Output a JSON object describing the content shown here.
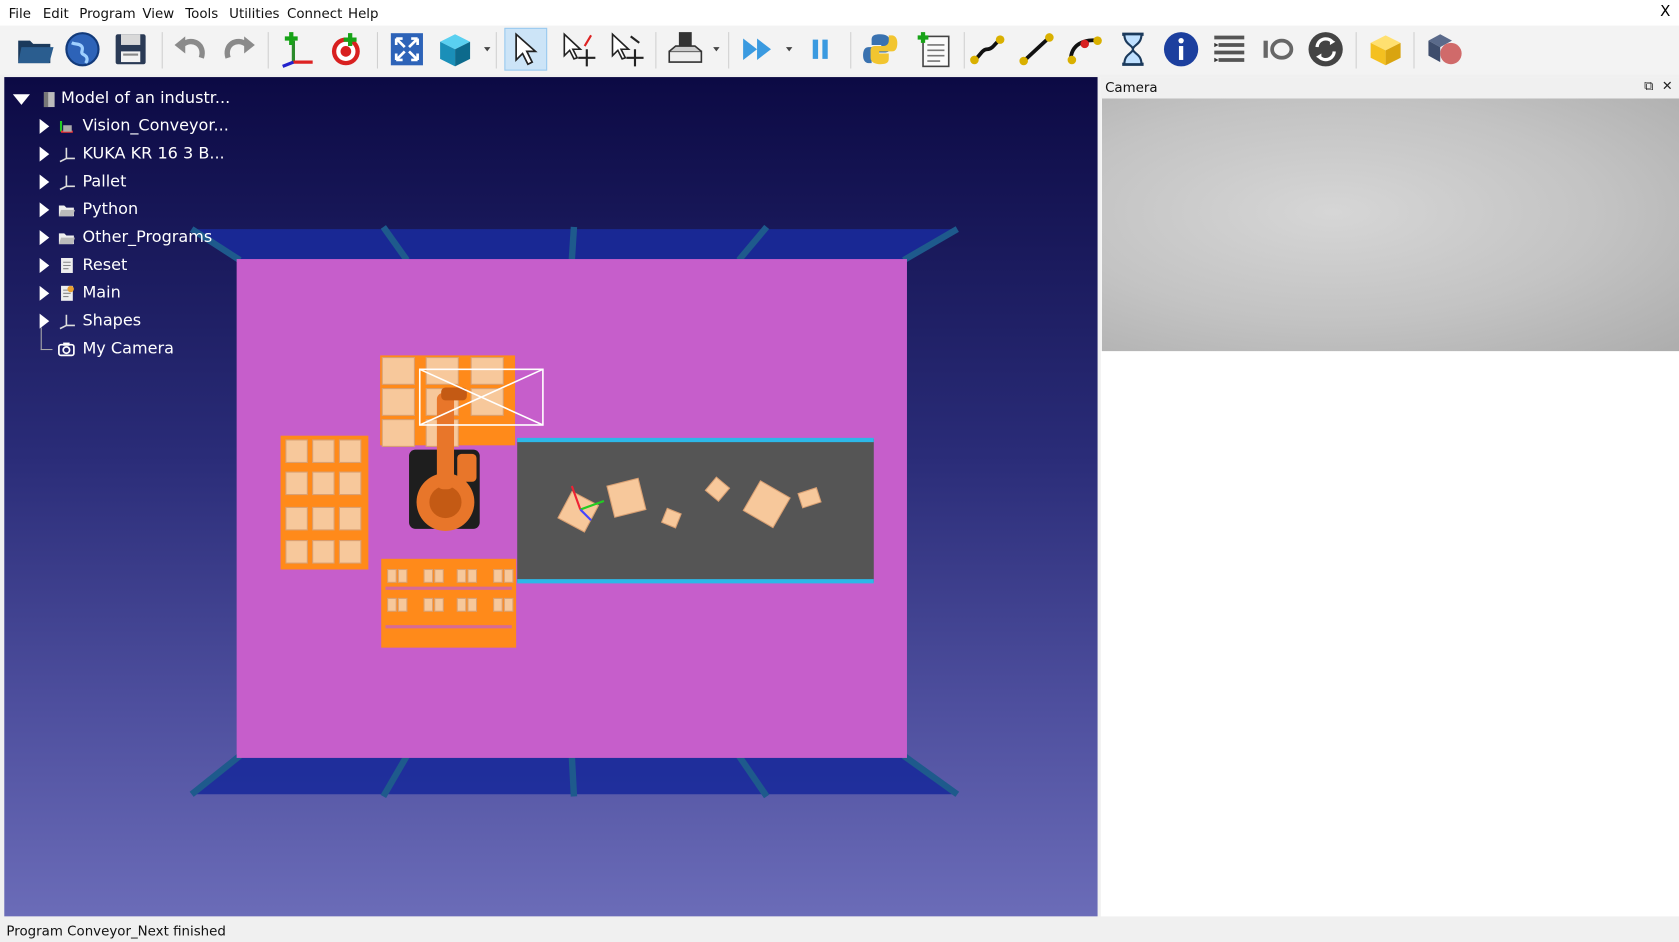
{
  "window": {
    "close_label": "X"
  },
  "menu": [
    "File",
    "Edit",
    "Program",
    "View",
    "Tools",
    "Utilities",
    "Connect",
    "Help"
  ],
  "toolbar": [
    "open-icon",
    "online-library-icon",
    "save-icon",
    "undo-icon",
    "redo-icon",
    "add-reference-frame-icon",
    "add-target-icon",
    "fit-all-icon",
    "view-3d-icon",
    "select-icon",
    "move-reference-icon",
    "move-object-icon",
    "tool-icon",
    "run-simulation-icon",
    "pause-icon",
    "add-python-program-icon",
    "add-program-icon",
    "joint-move-icon",
    "linear-move-icon",
    "circular-move-icon",
    "pause-instruction-icon",
    "info-icon",
    "program-instruction-icon",
    "io-icon",
    "reset-icon",
    "export-package-icon",
    "add-object-icon"
  ],
  "tree": {
    "root": "Model of an industr...",
    "items": [
      {
        "label": "Vision_Conveyor...",
        "icon": "robot-frame-icon",
        "expandable": true
      },
      {
        "label": "KUKA KR 16 3 B...",
        "icon": "frame-icon",
        "expandable": true
      },
      {
        "label": "Pallet",
        "icon": "frame-icon",
        "expandable": true
      },
      {
        "label": "Python",
        "icon": "folder-icon",
        "expandable": true
      },
      {
        "label": "Other_Programs",
        "icon": "folder-icon",
        "expandable": true
      },
      {
        "label": "Reset",
        "icon": "program-icon",
        "expandable": true
      },
      {
        "label": "Main",
        "icon": "program-icon",
        "expandable": true
      },
      {
        "label": "Shapes",
        "icon": "frame-icon",
        "expandable": true
      },
      {
        "label": "My Camera",
        "icon": "camera-icon",
        "expandable": false
      }
    ]
  },
  "panel": {
    "title": "Camera",
    "float_icon": "float-icon",
    "close_icon": "close-icon"
  },
  "status": {
    "text": "Program Conveyor_Next finished"
  },
  "colors": {
    "floor": "#c65ecb",
    "conveyor": "#555555",
    "conveyor_edge": "#2db8e8",
    "pallet": "#ff8a1a",
    "box": "#f7c89b",
    "robot": "#e8762a"
  }
}
